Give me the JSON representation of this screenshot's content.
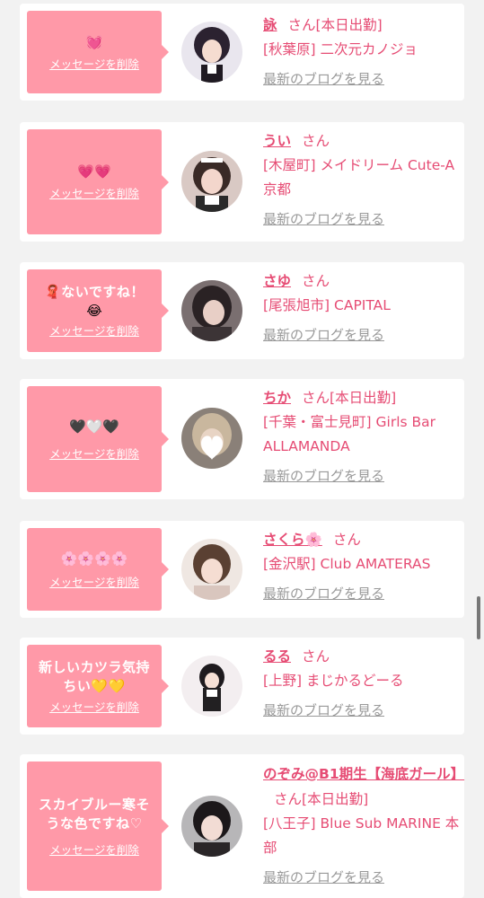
{
  "delete_label": "メッセージを削除",
  "blog_label": "最新のブログを見る",
  "honorific": "さん",
  "cards": [
    {
      "message": "",
      "emoji": "💓",
      "name": "詠",
      "status": "[本日出勤]",
      "shop": "[秋葉原] 二次元カノジョ",
      "avatar": "avatar-1"
    },
    {
      "message": "",
      "emoji": "💗💗",
      "name": "うい",
      "status": "",
      "shop": "[木屋町] メイドリーム Cute-A 京都",
      "avatar": "avatar-2"
    },
    {
      "message": "🧣ないですね！",
      "emoji": "😂",
      "name": "さゆ",
      "status": "",
      "shop": "[尾張旭市] CAPITAL",
      "avatar": "avatar-3"
    },
    {
      "message": "",
      "emoji": "🖤🤍🖤",
      "name": "ちか",
      "status": "[本日出勤]",
      "shop": "[千葉・富士見町] Girls Bar ALLAMANDA",
      "avatar": "avatar-4"
    },
    {
      "message": "",
      "emoji": "🌸🌸🌸🌸",
      "name": "さくら🌸",
      "status": "",
      "shop": "[金沢駅] Club AMATERAS",
      "avatar": "avatar-5"
    },
    {
      "message": "新しいカツラ気持ちい💛💛",
      "emoji": "",
      "name": "るる",
      "status": "",
      "shop": "[上野] まじかるどーる",
      "avatar": "avatar-6"
    },
    {
      "message": "スカイブルー寒そうな色ですね♡",
      "emoji": "",
      "name": "のぞみ@B1期生【海底ガール】",
      "status": "[本日出勤]",
      "shop": "[八王子] Blue Sub MARINE 本部",
      "avatar": "avatar-7"
    }
  ],
  "colors": {
    "accent": "#e64c74",
    "bubble": "#ff99a8",
    "link_gray": "#999999",
    "background": "#f2f2f2"
  }
}
